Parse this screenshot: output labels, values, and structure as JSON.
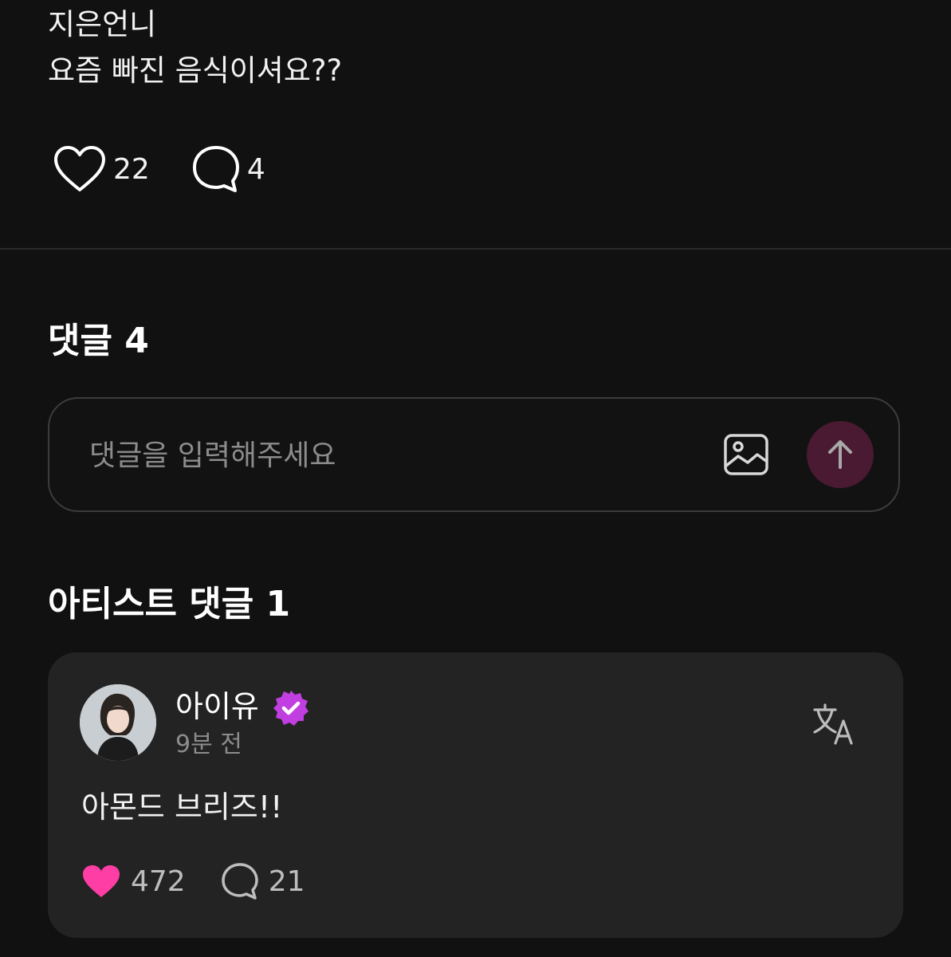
{
  "post": {
    "lines": [
      "지은언니",
      "요즘 빠진 음식이셔요??"
    ],
    "like_count": "22",
    "comment_count": "4"
  },
  "comments_section": {
    "title": "댓글 4",
    "input_placeholder": "댓글을 입력해주세요",
    "image_icon": "image-icon",
    "send_icon": "arrow-up-icon",
    "send_button_color": "#4a1a32"
  },
  "artist_section": {
    "title": "아티스트 댓글 1",
    "comment": {
      "author": "아이유",
      "verified_badge_color": "#c13fe0",
      "timestamp": "9분 전",
      "text": "아몬드 브리즈!!",
      "like_count": "472",
      "reply_count": "21",
      "liked": true,
      "like_color": "#ff3ea5"
    }
  }
}
